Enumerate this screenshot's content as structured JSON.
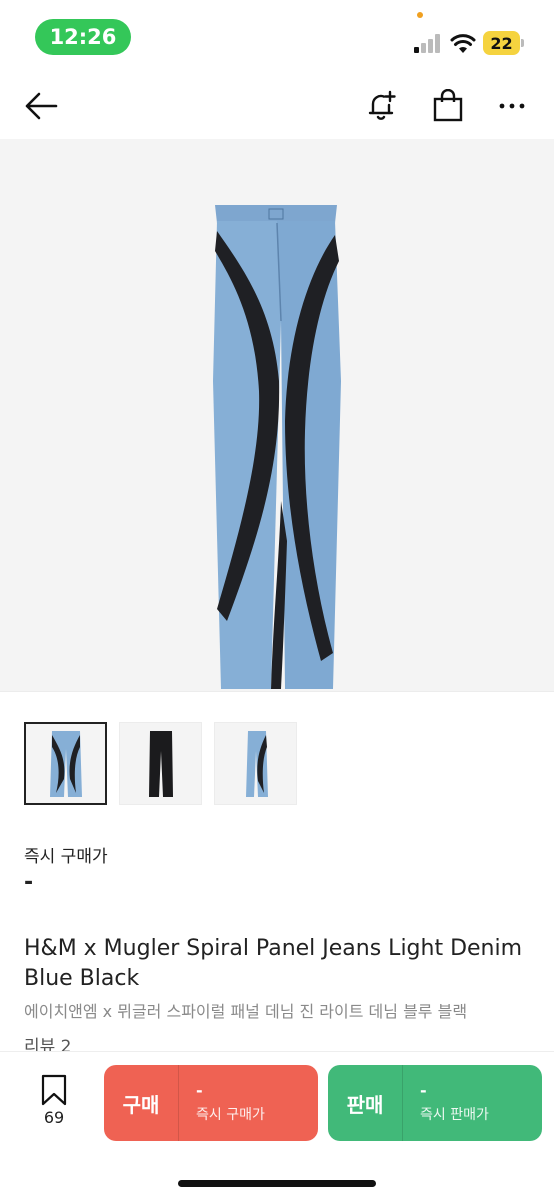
{
  "status_bar": {
    "time": "12:26",
    "battery": "22"
  },
  "product": {
    "price_label": "즉시 구매가",
    "price_value": "-",
    "title_en": "H&M x Mugler Spiral Panel Jeans Light Denim Blue Black",
    "title_ko": "에이치앤엠 x 뮈글러 스파이럴 패널 데님 진 라이트 데님 블루 블랙",
    "reviews": "리뷰 2"
  },
  "thumbnails": [
    {
      "icon": "jeans-spiral-front-image"
    },
    {
      "icon": "jeans-black-image"
    },
    {
      "icon": "jeans-spiral-side-image"
    }
  ],
  "bottom_bar": {
    "wish_count": "69",
    "buy": {
      "label": "구매",
      "price": "-",
      "caption": "즉시 구매가"
    },
    "sell": {
      "label": "판매",
      "price": "-",
      "caption": "즉시 판매가"
    }
  },
  "colors": {
    "buy": "#ef6253",
    "sell": "#41b979",
    "time_pill": "#34c759",
    "battery": "#f5d33f"
  }
}
